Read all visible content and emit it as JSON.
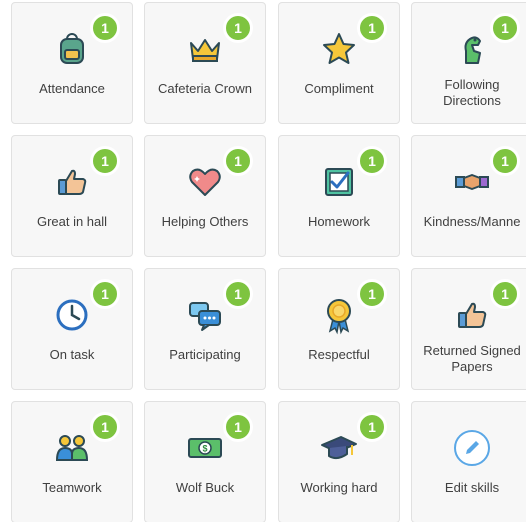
{
  "badge_color": "#7ec440",
  "skills": [
    {
      "label": "Attendance",
      "count": "1",
      "icon": "backpack-icon"
    },
    {
      "label": "Cafeteria Crown",
      "count": "1",
      "icon": "crown-icon"
    },
    {
      "label": "Compliment",
      "count": "1",
      "icon": "star-icon"
    },
    {
      "label": "Following Directions",
      "count": "1",
      "icon": "dinosaur-icon"
    },
    {
      "label": "Great in hall",
      "count": "1",
      "icon": "thumbs-up-icon"
    },
    {
      "label": "Helping Others",
      "count": "1",
      "icon": "heart-icon"
    },
    {
      "label": "Homework",
      "count": "1",
      "icon": "checkbox-icon"
    },
    {
      "label": "Kindness/Manne",
      "count": "1",
      "icon": "handshake-icon"
    },
    {
      "label": "On task",
      "count": "1",
      "icon": "clock-icon"
    },
    {
      "label": "Participating",
      "count": "1",
      "icon": "chat-bubbles-icon"
    },
    {
      "label": "Respectful",
      "count": "1",
      "icon": "award-medal-icon"
    },
    {
      "label": "Returned Signed Papers",
      "count": "1",
      "icon": "thumbs-up-icon"
    },
    {
      "label": "Teamwork",
      "count": "1",
      "icon": "team-people-icon"
    },
    {
      "label": "Wolf Buck",
      "count": "1",
      "icon": "dollar-bill-icon"
    },
    {
      "label": "Working hard",
      "count": "1",
      "icon": "graduation-cap-icon"
    }
  ],
  "edit": {
    "label": "Edit skills",
    "icon": "pencil-icon"
  }
}
